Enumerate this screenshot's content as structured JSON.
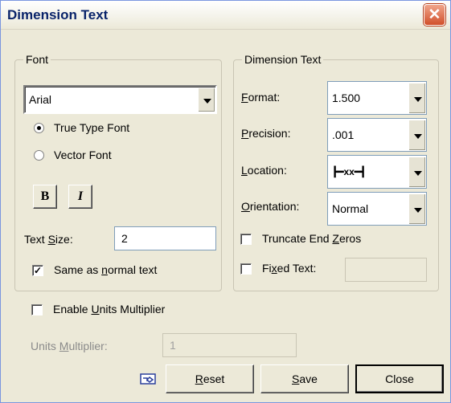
{
  "dialog": {
    "title": "Dimension Text"
  },
  "font_group": {
    "title": "Font",
    "font_name": "Arial",
    "true_type_label": "True Type Font",
    "vector_label": "Vector Font",
    "bold_label": "B",
    "italic_label": "I",
    "text_size_label_pre": "Text ",
    "text_size_label_u": "S",
    "text_size_label_post": "ize:",
    "text_size_value": "2",
    "same_label_pre": "Same as ",
    "same_label_u": "n",
    "same_label_post": "ormal text",
    "same_checked": true
  },
  "dim_group": {
    "title": "Dimension Text",
    "format_label_u": "F",
    "format_label_post": "ormat:",
    "format_value": "1.500",
    "precision_label_u": "P",
    "precision_label_post": "recision:",
    "precision_value": ".001",
    "location_label_u": "L",
    "location_label_post": "ocation:",
    "location_value": "xx",
    "orientation_label_u": "O",
    "orientation_label_post": "rientation:",
    "orientation_value": "Normal",
    "truncate_label_pre": "Truncate End ",
    "truncate_label_u": "Z",
    "truncate_label_post": "eros",
    "fixed_label_pre": "Fi",
    "fixed_label_u": "x",
    "fixed_label_post": "ed Text:",
    "fixed_value": ""
  },
  "units": {
    "enable_label_pre": "Enable ",
    "enable_label_u": "U",
    "enable_label_post": "nits Multiplier",
    "multiplier_label_pre": "Units ",
    "multiplier_label_u": "M",
    "multiplier_label_post": "ultiplier:",
    "multiplier_value": "1"
  },
  "buttons": {
    "reset_u": "R",
    "reset_post": "eset",
    "save_u": "S",
    "save_post": "ave",
    "close": "Close"
  }
}
